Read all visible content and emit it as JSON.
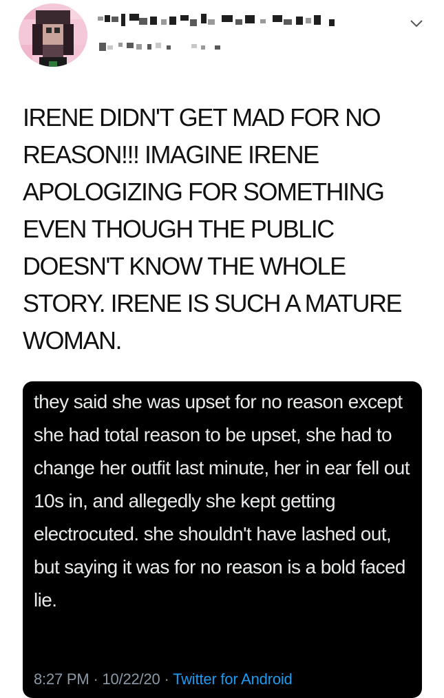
{
  "tweet": {
    "author_name": "",
    "author_handle": "",
    "text": "IRENE DIDN'T GET MAD FOR NO REASON!!! IMAGINE IRENE APOLOGIZING FOR SOMETHING EVEN THOUGH THE PUBLIC DOESN'T KNOW THE WHOLE STORY. IRENE IS SUCH A MATURE WOMAN.",
    "more_icon": "chevron-down-icon"
  },
  "quoted": {
    "text": "they said she was upset for no reason except she had total reason to be upset, she had to change her outfit last minute, her in ear fell out 10s in, and allegedly she kept getting electrocuted. she shouldn't have lashed out, but saying it was for no reason is a bold faced lie.",
    "time": "8:27 PM",
    "separator": " · ",
    "date": "10/22/20",
    "source": "Twitter for Android"
  },
  "colors": {
    "card_background": "#000000",
    "card_text": "#e7e9ea",
    "meta_text": "#8b98a5",
    "link": "#1d9bf0"
  }
}
